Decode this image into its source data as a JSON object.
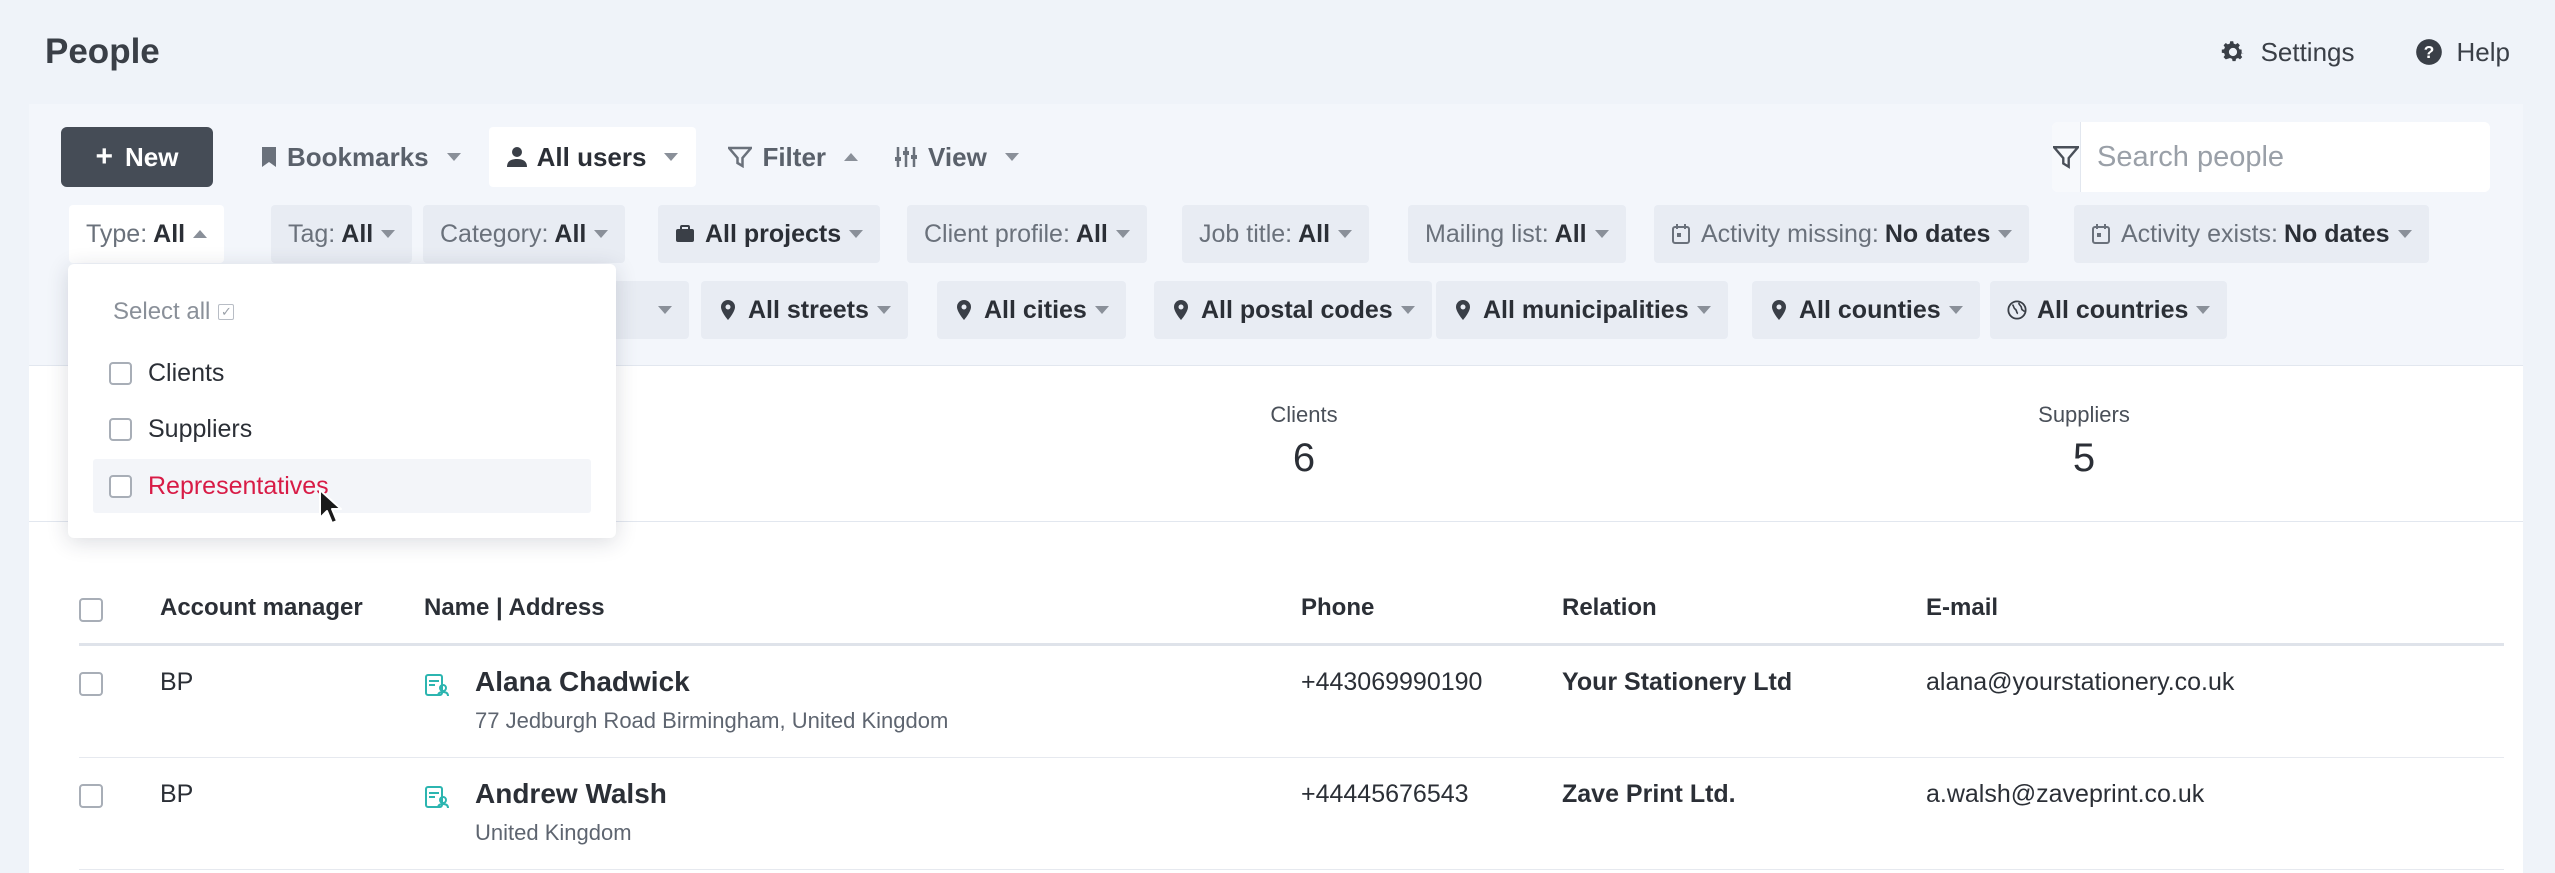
{
  "header": {
    "title": "People",
    "settings_label": "Settings",
    "help_label": "Help"
  },
  "toolbar": {
    "new_label": "New",
    "bookmarks_label": "Bookmarks",
    "users_label": "All users",
    "filter_label": "Filter",
    "view_label": "View",
    "search_placeholder": "Search people"
  },
  "filters": {
    "row1": [
      {
        "label": "Type:",
        "value": "All"
      },
      {
        "label": "Tag:",
        "value": "All"
      },
      {
        "label": "Category:",
        "value": "All"
      },
      {
        "label": "",
        "value": "All projects"
      },
      {
        "label": "Client profile:",
        "value": "All"
      },
      {
        "label": "Job title:",
        "value": "All"
      },
      {
        "label": "Mailing list:",
        "value": "All"
      },
      {
        "label": "Activity missing:",
        "value": "No dates"
      },
      {
        "label": "Activity exists:",
        "value": "No dates"
      }
    ],
    "row2": [
      {
        "label": "",
        "value": "All streets"
      },
      {
        "label": "",
        "value": "All cities"
      },
      {
        "label": "",
        "value": "All postal codes"
      },
      {
        "label": "",
        "value": "All municipalities"
      },
      {
        "label": "",
        "value": "All counties"
      },
      {
        "label": "",
        "value": "All countries"
      }
    ]
  },
  "type_dropdown": {
    "select_all": "Select all",
    "options": [
      "Clients",
      "Suppliers",
      "Representatives"
    ]
  },
  "stats": [
    {
      "label": "Clients",
      "value": "6"
    },
    {
      "label": "Suppliers",
      "value": "5"
    }
  ],
  "table": {
    "columns": [
      "Account manager",
      "Name | Address",
      "Phone",
      "Relation",
      "E-mail"
    ],
    "rows": [
      {
        "manager": "BP",
        "name": "Alana Chadwick",
        "address": "77 Jedburgh Road Birmingham, United Kingdom",
        "phone": "+443069990190",
        "relation": "Your Stationery Ltd",
        "email": "alana@yourstationery.co.uk"
      },
      {
        "manager": "BP",
        "name": "Andrew Walsh",
        "address": "United Kingdom",
        "phone": "+44445676543",
        "relation": "Zave Print Ltd.",
        "email": "a.walsh@zaveprint.co.uk"
      }
    ]
  },
  "colors": {
    "accent_dark": "#454c56",
    "hover_text": "#d81b46",
    "contact_icon": "#2cb5b0"
  }
}
